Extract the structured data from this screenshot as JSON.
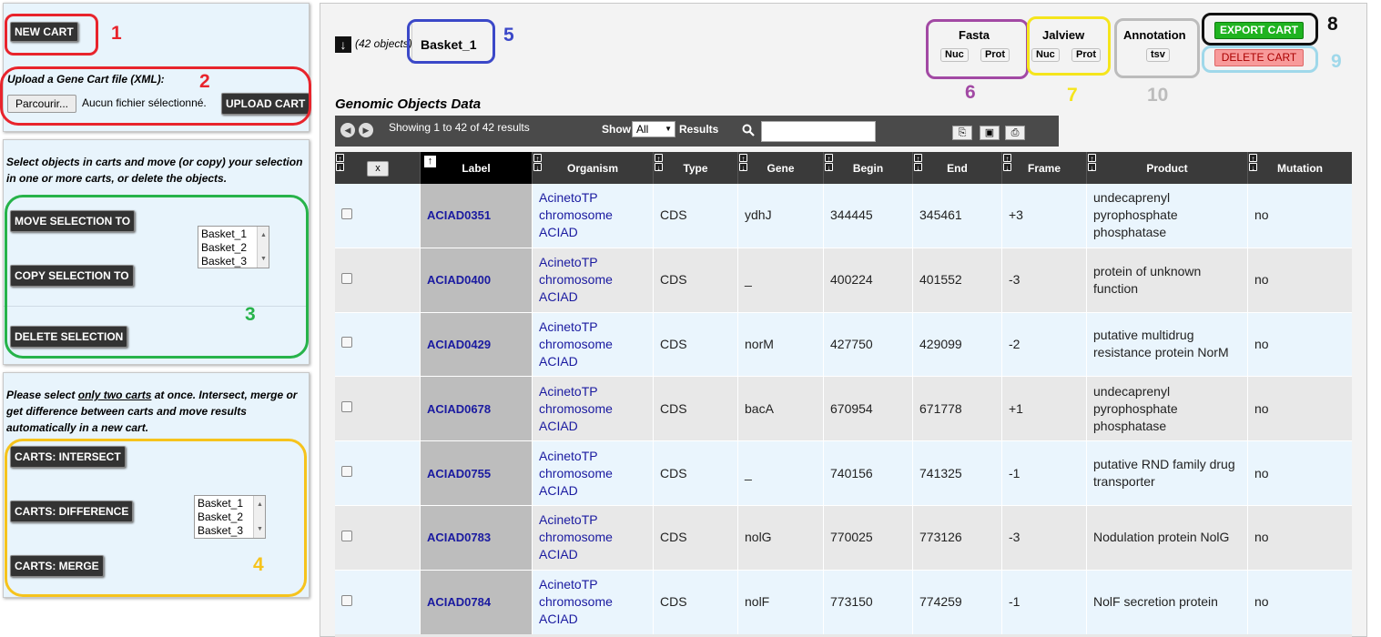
{
  "left": {
    "new_cart": "NEW CART",
    "upload_hint": "Upload a Gene Cart file (XML):",
    "browse": "Parcourir...",
    "no_file": "Aucun fichier sélectionné.",
    "upload_cart": "UPLOAD CART",
    "select_hint": "Select objects in carts and move (or copy) your selection in one or more carts, or delete the objects.",
    "move": "MOVE SELECTION TO",
    "copy": "COPY SELECTION TO",
    "delete": "DELETE SELECTION",
    "carts": [
      "Basket_1",
      "Basket_2",
      "Basket_3"
    ],
    "two_hint_a": "Please select ",
    "two_hint_u": "only two carts",
    "two_hint_b": " at once. Intersect, merge or get difference between carts and move results automatically in a new cart.",
    "intersect": "CARTS: INTERSECT",
    "difference": "CARTS: DIFFERENCE",
    "merge": "CARTS: MERGE"
  },
  "numbers": {
    "n1": "1",
    "n2": "2",
    "n3": "3",
    "n4": "4",
    "n5": "5",
    "n6": "6",
    "n7": "7",
    "n8": "8",
    "n9": "9",
    "n10": "10"
  },
  "header": {
    "count": "(42 objects)",
    "basket": "Basket_1",
    "fasta": "Fasta",
    "jalview": "Jalview",
    "annotation": "Annotation",
    "nuc": "Nuc",
    "prot": "Prot",
    "tsv": "tsv",
    "export": "EXPORT CART",
    "delete_cart": "DELETE CART"
  },
  "section_title": "Genomic Objects Data",
  "toolbar": {
    "showing": "Showing 1 to 42 of 42 results",
    "show": "Show",
    "show_value": "All",
    "results": "Results"
  },
  "columns": {
    "x": "x",
    "label": "Label",
    "organism": "Organism",
    "type": "Type",
    "gene": "Gene",
    "begin": "Begin",
    "end": "End",
    "frame": "Frame",
    "product": "Product",
    "mutation": "Mutation"
  },
  "rows": [
    {
      "label": "ACIAD0351",
      "org1": "AcinetoTP",
      "org2": "chromosome",
      "org3": "ACIAD",
      "type": "CDS",
      "gene": "ydhJ",
      "begin": "344445",
      "end": "345461",
      "frame": "+3",
      "p1": "undecaprenyl",
      "p2": "pyrophosphate",
      "p3": "phosphatase",
      "mutation": "no"
    },
    {
      "label": "ACIAD0400",
      "org1": "AcinetoTP",
      "org2": "chromosome",
      "org3": "ACIAD",
      "type": "CDS",
      "gene": "_",
      "begin": "400224",
      "end": "401552",
      "frame": "-3",
      "p1": "protein of unknown",
      "p2": "function",
      "p3": "",
      "mutation": "no"
    },
    {
      "label": "ACIAD0429",
      "org1": "AcinetoTP",
      "org2": "chromosome",
      "org3": "ACIAD",
      "type": "CDS",
      "gene": "norM",
      "begin": "427750",
      "end": "429099",
      "frame": "-2",
      "p1": "putative multidrug",
      "p2": "resistance protein NorM",
      "p3": "",
      "mutation": "no"
    },
    {
      "label": "ACIAD0678",
      "org1": "AcinetoTP",
      "org2": "chromosome",
      "org3": "ACIAD",
      "type": "CDS",
      "gene": "bacA",
      "begin": "670954",
      "end": "671778",
      "frame": "+1",
      "p1": "undecaprenyl",
      "p2": "pyrophosphate",
      "p3": "phosphatase",
      "mutation": "no"
    },
    {
      "label": "ACIAD0755",
      "org1": "AcinetoTP",
      "org2": "chromosome",
      "org3": "ACIAD",
      "type": "CDS",
      "gene": "_",
      "begin": "740156",
      "end": "741325",
      "frame": "-1",
      "p1": "putative RND family drug",
      "p2": "transporter",
      "p3": "",
      "mutation": "no"
    },
    {
      "label": "ACIAD0783",
      "org1": "AcinetoTP",
      "org2": "chromosome",
      "org3": "ACIAD",
      "type": "CDS",
      "gene": "nolG",
      "begin": "770025",
      "end": "773126",
      "frame": "-3",
      "p1": "Nodulation protein NolG",
      "p2": "",
      "p3": "",
      "mutation": "no"
    },
    {
      "label": "ACIAD0784",
      "org1": "AcinetoTP",
      "org2": "chromosome",
      "org3": "ACIAD",
      "type": "CDS",
      "gene": "nolF",
      "begin": "773150",
      "end": "774259",
      "frame": "-1",
      "p1": "NolF secretion protein",
      "p2": "",
      "p3": "",
      "mutation": "no"
    }
  ],
  "colors": {
    "red": "#e8242c",
    "blue": "#3b48c8",
    "purple": "#a249a4",
    "yellow": "#f5e51c",
    "grey": "#bcbcbc",
    "black": "#111111",
    "lightblue": "#9fd8ea",
    "green": "#27b34a",
    "gold": "#f6c31c",
    "export": "#1fb320",
    "deletecart": "#f89a9a"
  }
}
